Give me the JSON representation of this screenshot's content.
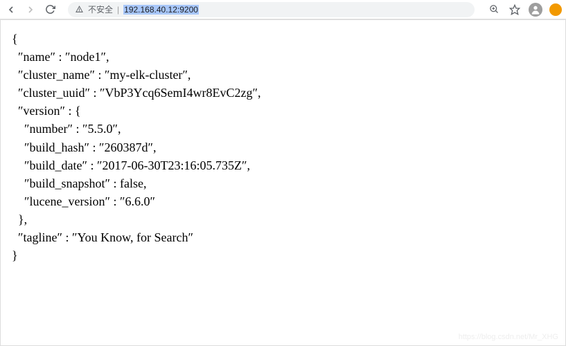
{
  "toolbar": {
    "security_label": "不安全",
    "url": "192.168.40.12:9200"
  },
  "response": {
    "name_key": "name",
    "name_val": "node1",
    "cluster_name_key": "cluster_name",
    "cluster_name_val": "my-elk-cluster",
    "cluster_uuid_key": "cluster_uuid",
    "cluster_uuid_val": "VbP3Ycq6SemI4wr8EvC2zg",
    "version_key": "version",
    "number_key": "number",
    "number_val": "5.5.0",
    "build_hash_key": "build_hash",
    "build_hash_val": "260387d",
    "build_date_key": "build_date",
    "build_date_val": "2017-06-30T23:16:05.735Z",
    "build_snapshot_key": "build_snapshot",
    "build_snapshot_val": "false",
    "lucene_version_key": "lucene_version",
    "lucene_version_val": "6.6.0",
    "tagline_key": "tagline",
    "tagline_val": "You Know, for Search"
  },
  "watermark": "https://blog.csdn.net/Mr_XHG"
}
